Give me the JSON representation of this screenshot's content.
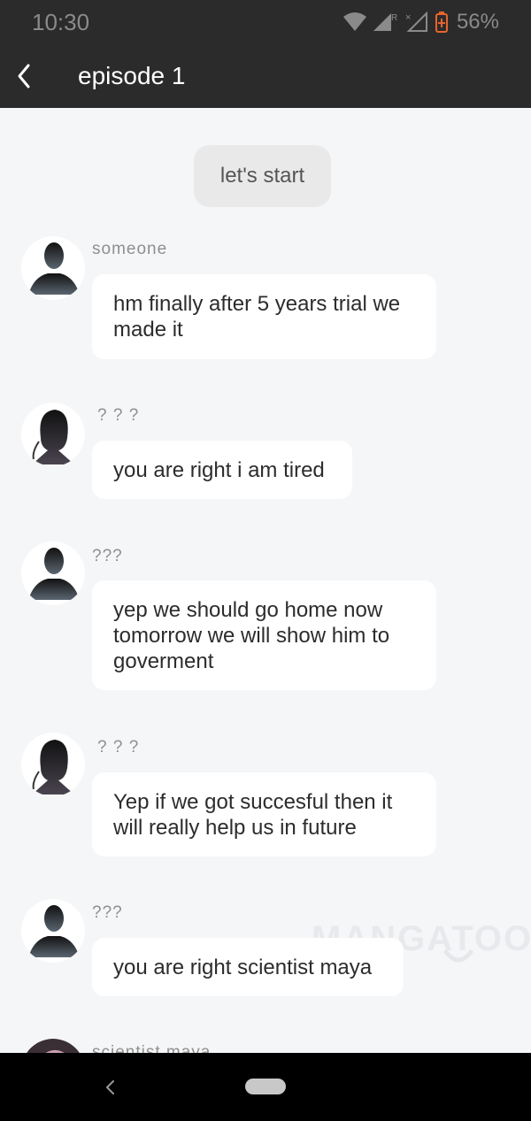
{
  "status_bar": {
    "time": "10:30",
    "battery": "56%"
  },
  "app_bar": {
    "title": "episode 1"
  },
  "chat": {
    "system_message": "let's start",
    "messages": [
      {
        "sender": "someone",
        "text": "hm finally after 5 years trial we made it",
        "avatar": "male-silhouette"
      },
      {
        "sender": "? ? ?",
        "text": "you are right i am tired",
        "avatar": "female-silhouette"
      },
      {
        "sender": "???",
        "text": "yep we should go home now tomorrow we will show him to goverment",
        "avatar": "male-silhouette"
      },
      {
        "sender": "? ? ?",
        "text": "Yep if we got succesful then it will really help us in future",
        "avatar": "female-silhouette"
      },
      {
        "sender": "???",
        "text": "you are right scientist maya",
        "avatar": "male-silhouette"
      },
      {
        "sender": "scientist maya",
        "avatar": "female-photo"
      }
    ],
    "watermark": "MANGATOON"
  },
  "colors": {
    "app_bar": "#2b2b2b",
    "background": "#f5f6f8",
    "bubble": "#ffffff",
    "battery_icon": "#e8642c"
  }
}
